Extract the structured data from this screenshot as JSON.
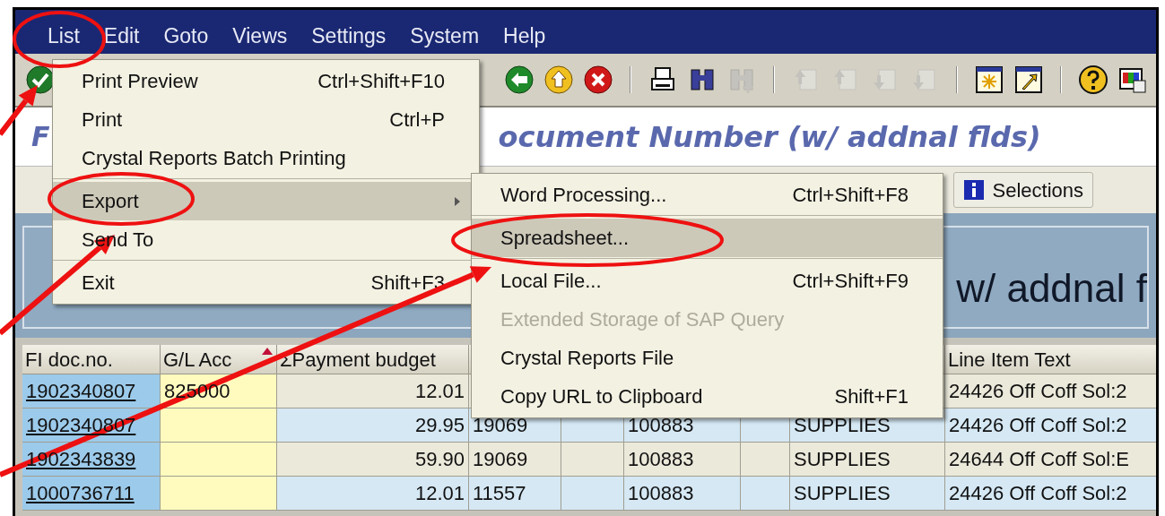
{
  "menu_bar": [
    {
      "label": "List"
    },
    {
      "label": "Edit"
    },
    {
      "label": "Goto"
    },
    {
      "label": "Views"
    },
    {
      "label": "Settings"
    },
    {
      "label": "System"
    },
    {
      "label": "Help"
    }
  ],
  "toolbar": [
    {
      "kind": "enter",
      "disabled": false
    },
    {
      "kind": "back",
      "disabled": false
    },
    {
      "kind": "exit",
      "disabled": false
    },
    {
      "kind": "cancel",
      "disabled": false
    },
    {
      "kind": "sep"
    },
    {
      "kind": "print",
      "disabled": false
    },
    {
      "kind": "find",
      "disabled": false
    },
    {
      "kind": "find_next",
      "disabled": true
    },
    {
      "kind": "sep"
    },
    {
      "kind": "first_page",
      "disabled": true
    },
    {
      "kind": "prev_page",
      "disabled": true
    },
    {
      "kind": "next_page",
      "disabled": true
    },
    {
      "kind": "last_page",
      "disabled": true
    },
    {
      "kind": "sep"
    },
    {
      "kind": "new_session",
      "disabled": false
    },
    {
      "kind": "shortcut",
      "disabled": false
    },
    {
      "kind": "sep"
    },
    {
      "kind": "help",
      "disabled": false
    },
    {
      "kind": "layout",
      "disabled": false
    }
  ],
  "title": {
    "left_part": "F",
    "right_part": "ocument Number (w/ addnal flds)"
  },
  "app_toolbar": {
    "selections_button": "Selections"
  },
  "header_panel": {
    "right_part": "w/ addnal f"
  },
  "table": {
    "columns": [
      {
        "label": "FI doc.no."
      },
      {
        "label": "G/L Acc",
        "sorted": true
      },
      {
        "label": "ΣPayment budget"
      },
      {},
      {},
      {},
      {},
      {},
      {
        "label": "Line Item Text"
      }
    ],
    "rows": [
      [
        "1902340807",
        "825000",
        "12.01",
        null,
        null,
        null,
        null,
        null,
        "24426 Off Coff Sol:2"
      ],
      [
        "1902340807",
        null,
        "29.95",
        "19069",
        null,
        "100883",
        null,
        "SUPPLIES",
        "24426 Off Coff Sol:2"
      ],
      [
        "1902343839",
        null,
        "59.90",
        "19069",
        null,
        "100883",
        null,
        "SUPPLIES",
        "24644 Off Coff Sol:E"
      ],
      [
        "1000736711",
        null,
        "12.01",
        "11557",
        null,
        "100883",
        null,
        "SUPPLIES",
        "24426 Off Coff Sol:2"
      ]
    ]
  },
  "list_menu": [
    {
      "kind": "item",
      "label": "Print Preview",
      "shortcut": "Ctrl+Shift+F10",
      "selected": false,
      "has_submenu": false
    },
    {
      "kind": "item",
      "label": "Print",
      "shortcut": "Ctrl+P",
      "selected": false,
      "has_submenu": false
    },
    {
      "kind": "item",
      "label": "Crystal Reports Batch Printing",
      "selected": false,
      "has_submenu": false
    },
    {
      "kind": "separator"
    },
    {
      "kind": "item",
      "label": "Export",
      "selected": true,
      "has_submenu": true
    },
    {
      "kind": "item",
      "label": "Send To",
      "selected": false,
      "has_submenu": false
    },
    {
      "kind": "separator"
    },
    {
      "kind": "item",
      "label": "Exit",
      "shortcut": "Shift+F3",
      "selected": false,
      "has_submenu": false
    }
  ],
  "export_submenu": [
    {
      "kind": "item",
      "label": "Word Processing...",
      "shortcut": "Ctrl+Shift+F8",
      "selected": false,
      "disabled": false
    },
    {
      "kind": "separator"
    },
    {
      "kind": "item",
      "label": "Spreadsheet...",
      "selected": true,
      "disabled": false
    },
    {
      "kind": "separator"
    },
    {
      "kind": "item",
      "label": "Local File...",
      "shortcut": "Ctrl+Shift+F9",
      "selected": false,
      "disabled": false
    },
    {
      "kind": "item",
      "label": "Extended Storage of SAP Query",
      "selected": false,
      "disabled": true
    },
    {
      "kind": "item",
      "label": "Crystal Reports File",
      "selected": false,
      "disabled": false
    },
    {
      "kind": "item",
      "label": "Copy URL to Clipboard",
      "shortcut": "Shift+F1",
      "selected": false,
      "disabled": false
    }
  ],
  "annotations": [
    {
      "kind": "ellipse"
    },
    {
      "kind": "ellipse"
    },
    {
      "kind": "ellipse"
    },
    {
      "kind": "arrow"
    },
    {
      "kind": "arrow"
    },
    {
      "kind": "arrow"
    }
  ]
}
